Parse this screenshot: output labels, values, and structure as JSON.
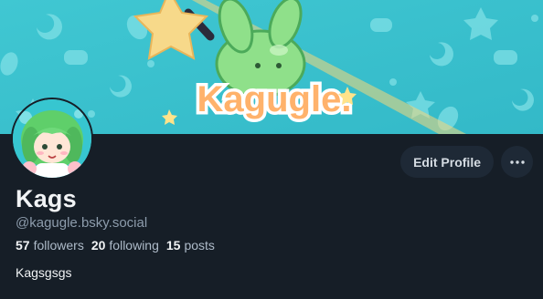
{
  "banner": {
    "logo_text": "Kagugle."
  },
  "profile": {
    "display_name": "Kags",
    "handle": "@kagugle.bsky.social",
    "bio": "Kagsgsgs"
  },
  "stats": {
    "followers_count": "57",
    "followers_label": "followers",
    "following_count": "20",
    "following_label": "following",
    "posts_count": "15",
    "posts_label": "posts"
  },
  "actions": {
    "edit_profile_label": "Edit Profile",
    "more_icon": "ellipsis-icon"
  },
  "colors": {
    "background": "#161e27",
    "button_bg": "#1e2936",
    "banner_teal": "#3cc4cf"
  }
}
